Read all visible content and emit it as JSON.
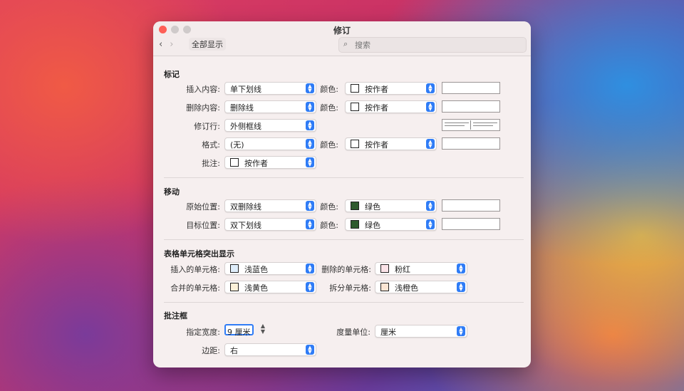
{
  "window": {
    "title": "修订",
    "show_all": "全部显示",
    "back_glyph": "‹",
    "forward_glyph": "›",
    "search_placeholder": "搜索",
    "search_glyph": "⌕"
  },
  "markup": {
    "header": "标记",
    "insert_label": "插入内容:",
    "insert_value": "单下划线",
    "delete_label": "删除内容:",
    "delete_value": "删除线",
    "revision_line_label": "修订行:",
    "revision_line_value": "外侧框线",
    "format_label": "格式:",
    "format_value": "(无)",
    "comment_label": "批注:",
    "comment_value": "按作者",
    "color_label": "颜色:",
    "insert_color": "按作者",
    "delete_color": "按作者",
    "format_color": "按作者"
  },
  "move": {
    "header": "移动",
    "from_label": "原始位置:",
    "from_value": "双删除线",
    "to_label": "目标位置:",
    "to_value": "双下划线",
    "color_label": "颜色:",
    "from_color": "绿色",
    "to_color": "绿色",
    "green_hex": "#2e5a2e"
  },
  "table_cells": {
    "header": "表格单元格突出显示",
    "inserted_label": "插入的单元格:",
    "inserted_value": "浅蓝色",
    "inserted_hex": "#dfeefb",
    "deleted_label": "删除的单元格:",
    "deleted_value": "粉红",
    "deleted_hex": "#fbe3e8",
    "merged_label": "合并的单元格:",
    "merged_value": "浅黄色",
    "merged_hex": "#fbf1d9",
    "split_label": "拆分单元格:",
    "split_value": "浅橙色",
    "split_hex": "#fbe6d4"
  },
  "balloons": {
    "header": "批注框",
    "width_label": "指定宽度:",
    "width_value": "9 厘米",
    "unit_label": "度量单位:",
    "unit_value": "厘米",
    "margin_label": "边距:",
    "margin_value": "右"
  },
  "colors": {
    "accent": "#2f7cf6",
    "close": "#fe5f57"
  }
}
